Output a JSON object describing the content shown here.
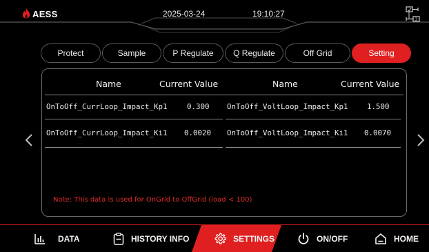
{
  "header": {
    "brand": "AESS",
    "date": "2025-03-24",
    "time": "19:10:27",
    "network_icon": "network-topology-icon"
  },
  "tabs": [
    {
      "label": "Protect",
      "active": false
    },
    {
      "label": "Sample",
      "active": false
    },
    {
      "label": "P Regulate",
      "active": false
    },
    {
      "label": "Q Regulate",
      "active": false
    },
    {
      "label": "Off Grid",
      "active": false
    },
    {
      "label": "Setting",
      "active": true
    }
  ],
  "table": {
    "headers": {
      "name": "Name",
      "value": "Current Value"
    },
    "left_rows": [
      {
        "name": "OnToOff_CurrLoop_Impact_Kp1",
        "value": "0.300"
      },
      {
        "name": "OnToOff_CurrLoop_Impact_Ki1",
        "value": "0.0020"
      }
    ],
    "right_rows": [
      {
        "name": "OnToOff_VoltLoop_Impact_Kp1",
        "value": "1.500"
      },
      {
        "name": "OnToOff_VoltLoop_Impact_Ki1",
        "value": "0.0070"
      }
    ]
  },
  "note": "Note: This data is used for OnGrid to OffGrid (load < 100)",
  "nav": [
    {
      "label": "DATA",
      "icon": "bar-chart-icon",
      "active": false
    },
    {
      "label": "HISTORY INFO",
      "icon": "clipboard-icon",
      "active": false
    },
    {
      "label": "SETTINGS",
      "icon": "gear-icon",
      "active": true
    },
    {
      "label": "ON/OFF",
      "icon": "power-icon",
      "active": false
    },
    {
      "label": "HOME",
      "icon": "home-icon",
      "active": false
    }
  ],
  "colors": {
    "accent": "#e02020",
    "background": "#000000",
    "border": "#6a6a6a",
    "note": "#e02a2a"
  }
}
